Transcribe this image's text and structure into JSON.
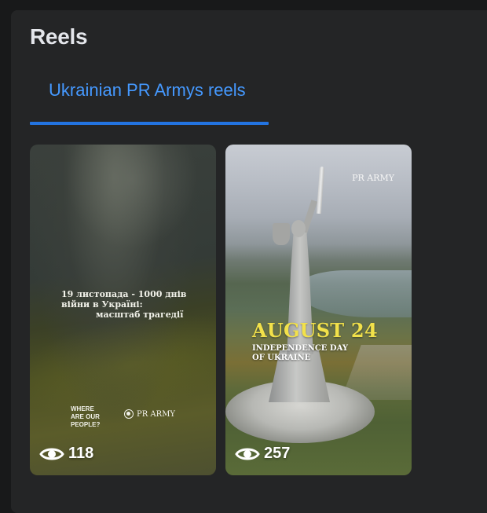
{
  "section": {
    "title": "Reels"
  },
  "tabs": [
    {
      "label": "Ukrainian PR Armys reels",
      "active": true
    }
  ],
  "reels": [
    {
      "caption_lines": [
        "19 листопада - 1000 днів",
        "війни в Україні:",
        "масштаб трагедії"
      ],
      "tagline_lines": [
        "WHERE",
        "ARE OUR",
        "PEOPLE?"
      ],
      "brand": "PR ARMY",
      "views": "118"
    },
    {
      "brand": "PR ARMY",
      "headline": "AUGUST 24",
      "subtitle_lines": [
        "INDEPENDENCE DAY",
        "OF UKRAINE"
      ],
      "views": "257"
    }
  ],
  "colors": {
    "background": "#18191a",
    "panel": "#242526",
    "accent": "#2374e1",
    "tab_text": "#4599ff",
    "headline": "#f2e14a"
  },
  "icons": {
    "views": "eye-icon",
    "brand": "pr-army-logo-icon"
  }
}
